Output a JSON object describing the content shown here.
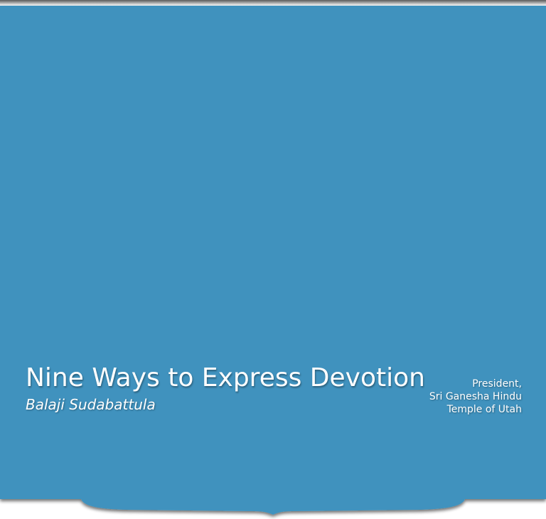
{
  "banner": {
    "title": "Nine Ways to Express Devotion",
    "author": "Balaji Sudabattula",
    "affiliation": {
      "line1": "President,",
      "line2": "Sri Ganesha Hindu",
      "line3": "Temple of Utah"
    }
  },
  "colors": {
    "banner_blue": "#3f92be",
    "text": "#ffffff",
    "page_background": "#ffffff"
  }
}
